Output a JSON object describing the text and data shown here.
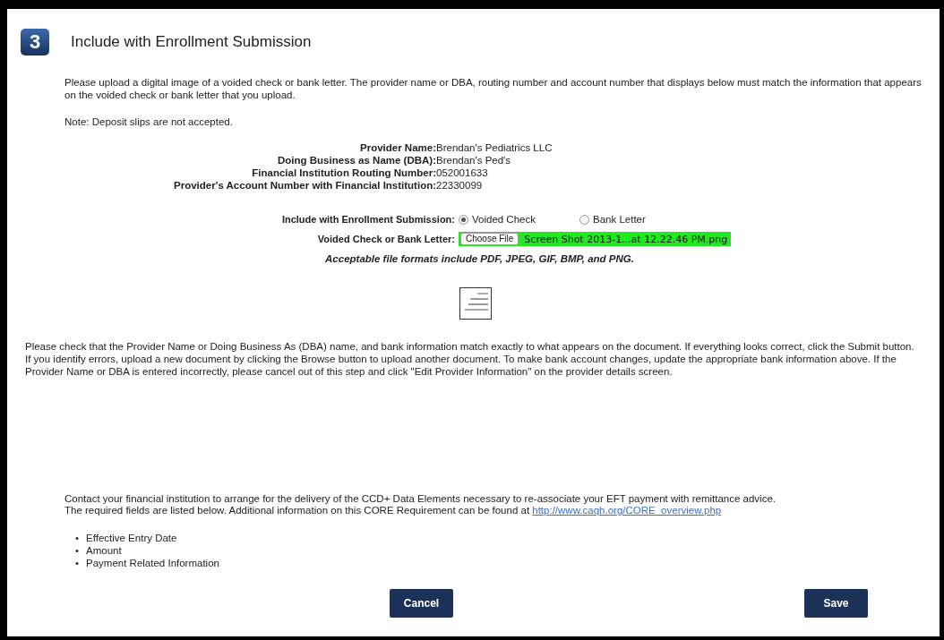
{
  "step": {
    "number": "3",
    "title": "Include with Enrollment Submission"
  },
  "intro": "Please upload a digital image of a voided check or bank letter. The provider name or DBA, routing number and account number that displays below must match the information that appears on the voided check or bank letter that you upload.",
  "note": "Note: Deposit slips are not accepted.",
  "details": [
    {
      "label": "Provider Name:",
      "value": "Brendan's Pediatrics LLC"
    },
    {
      "label": "Doing Business as Name (DBA):",
      "value": "Brendan's Ped's"
    },
    {
      "label": "Financial Institution Routing Number:",
      "value": "052001633"
    },
    {
      "label": "Provider's Account Number with Financial Institution:",
      "value": "22330099"
    }
  ],
  "submission": {
    "label": "Include with Enrollment Submission:",
    "options": [
      {
        "label": "Voided Check",
        "selected": true
      },
      {
        "label": "Bank Letter",
        "selected": false
      }
    ]
  },
  "file": {
    "label": "Voided Check or Bank Letter:",
    "button": "Choose File",
    "filename": "Screen Shot 2013-1...at 12.22.46 PM.png"
  },
  "formats": "Acceptable file formats include PDF, JPEG, GIF, BMP, and PNG.",
  "check_text": "Please check that the Provider Name or Doing Business As (DBA) name, and bank information match exactly to what appears on the document. If everything looks correct, click the Submit button. If you identify errors, upload a new document by clicking the Browse button to upload another document. To make bank account changes, update the appropriate bank information above. If the Provider Name or DBA is entered incorrectly, please cancel out of this step and click \"Edit Provider Information\" on the provider details screen.",
  "contact": {
    "line1": "Contact your financial institution to arrange for the delivery of the CCD+ Data Elements necessary to re-associate your EFT payment with remittance advice.",
    "line2": "The required fields are listed below. Additional information on this CORE Requirement can be found at",
    "link": "http://www.caqh.org/CORE_overview.php"
  },
  "required_fields": [
    {
      "bullet": "•",
      "text": "Effective Entry Date"
    },
    {
      "bullet": "•",
      "text": "Amount"
    },
    {
      "bullet": "•",
      "text": "Payment Related Information"
    }
  ],
  "buttons": {
    "cancel": "Cancel",
    "save": "Save"
  }
}
